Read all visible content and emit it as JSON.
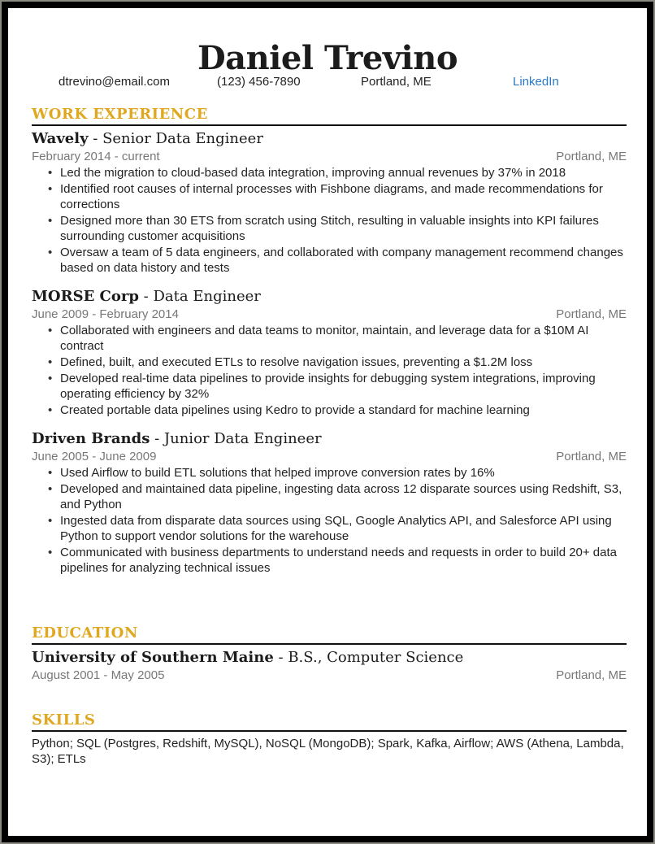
{
  "header": {
    "name": "Daniel Trevino",
    "email": "dtrevino@email.com",
    "phone": "(123) 456-7890",
    "location": "Portland, ME",
    "link_label": "LinkedIn"
  },
  "colors": {
    "section_heading": "#e0a820",
    "link": "#2a7ac7",
    "meta_text": "#777777"
  },
  "work": {
    "title": "WORK EXPERIENCE",
    "jobs": [
      {
        "company": "Wavely",
        "separator": " - ",
        "role": "Senior Data Engineer",
        "dates": "February 2014 - current",
        "location": "Portland, ME",
        "bullets": [
          "Led the migration to cloud-based data integration, improving annual revenues by 37% in 2018",
          "Identified root causes of internal processes with Fishbone diagrams, and made recommendations for corrections",
          "Designed more than 30 ETS from scratch using Stitch, resulting in valuable insights into KPI failures surrounding customer acquisitions",
          "Oversaw a team of 5 data engineers, and collaborated with company management recommend changes based on data history and tests"
        ]
      },
      {
        "company": "MORSE Corp",
        "separator": " - ",
        "role": "Data Engineer",
        "dates": "June 2009 - February 2014",
        "location": "Portland, ME",
        "bullets": [
          "Collaborated with engineers and data teams to monitor, maintain, and leverage data for a $10M AI contract",
          "Defined, built, and executed ETLs to resolve navigation issues, preventing a $1.2M loss",
          "Developed real-time data pipelines to provide insights for debugging system integrations, improving operating efficiency by 32%",
          "Created portable data pipelines using Kedro to provide a standard for machine learning"
        ]
      },
      {
        "company": "Driven Brands",
        "separator": " - ",
        "role": "Junior Data Engineer",
        "dates": "June 2005 - June 2009",
        "location": "Portland, ME",
        "bullets": [
          "Used Airflow to build ETL solutions that helped improve conversion rates by 16%",
          "Developed and maintained data pipeline, ingesting data across 12 disparate sources using Redshift, S3, and Python",
          "Ingested data from disparate data sources using SQL, Google Analytics API, and Salesforce API using Python to support vendor solutions for the warehouse",
          "Communicated with business departments to understand needs and requests in order to build 20+ data pipelines for analyzing technical issues"
        ]
      }
    ]
  },
  "education": {
    "title": "EDUCATION",
    "school": "University of Southern Maine",
    "separator": " - ",
    "degree": "B.S., Computer Science",
    "dates": "August 2001 - May 2005",
    "location": "Portland, ME"
  },
  "skills": {
    "title": "SKILLS",
    "text": "Python; SQL (Postgres, Redshift, MySQL), NoSQL (MongoDB); Spark, Kafka, Airflow; AWS (Athena, Lambda, S3); ETLs"
  },
  "bullet_glyph": "•"
}
